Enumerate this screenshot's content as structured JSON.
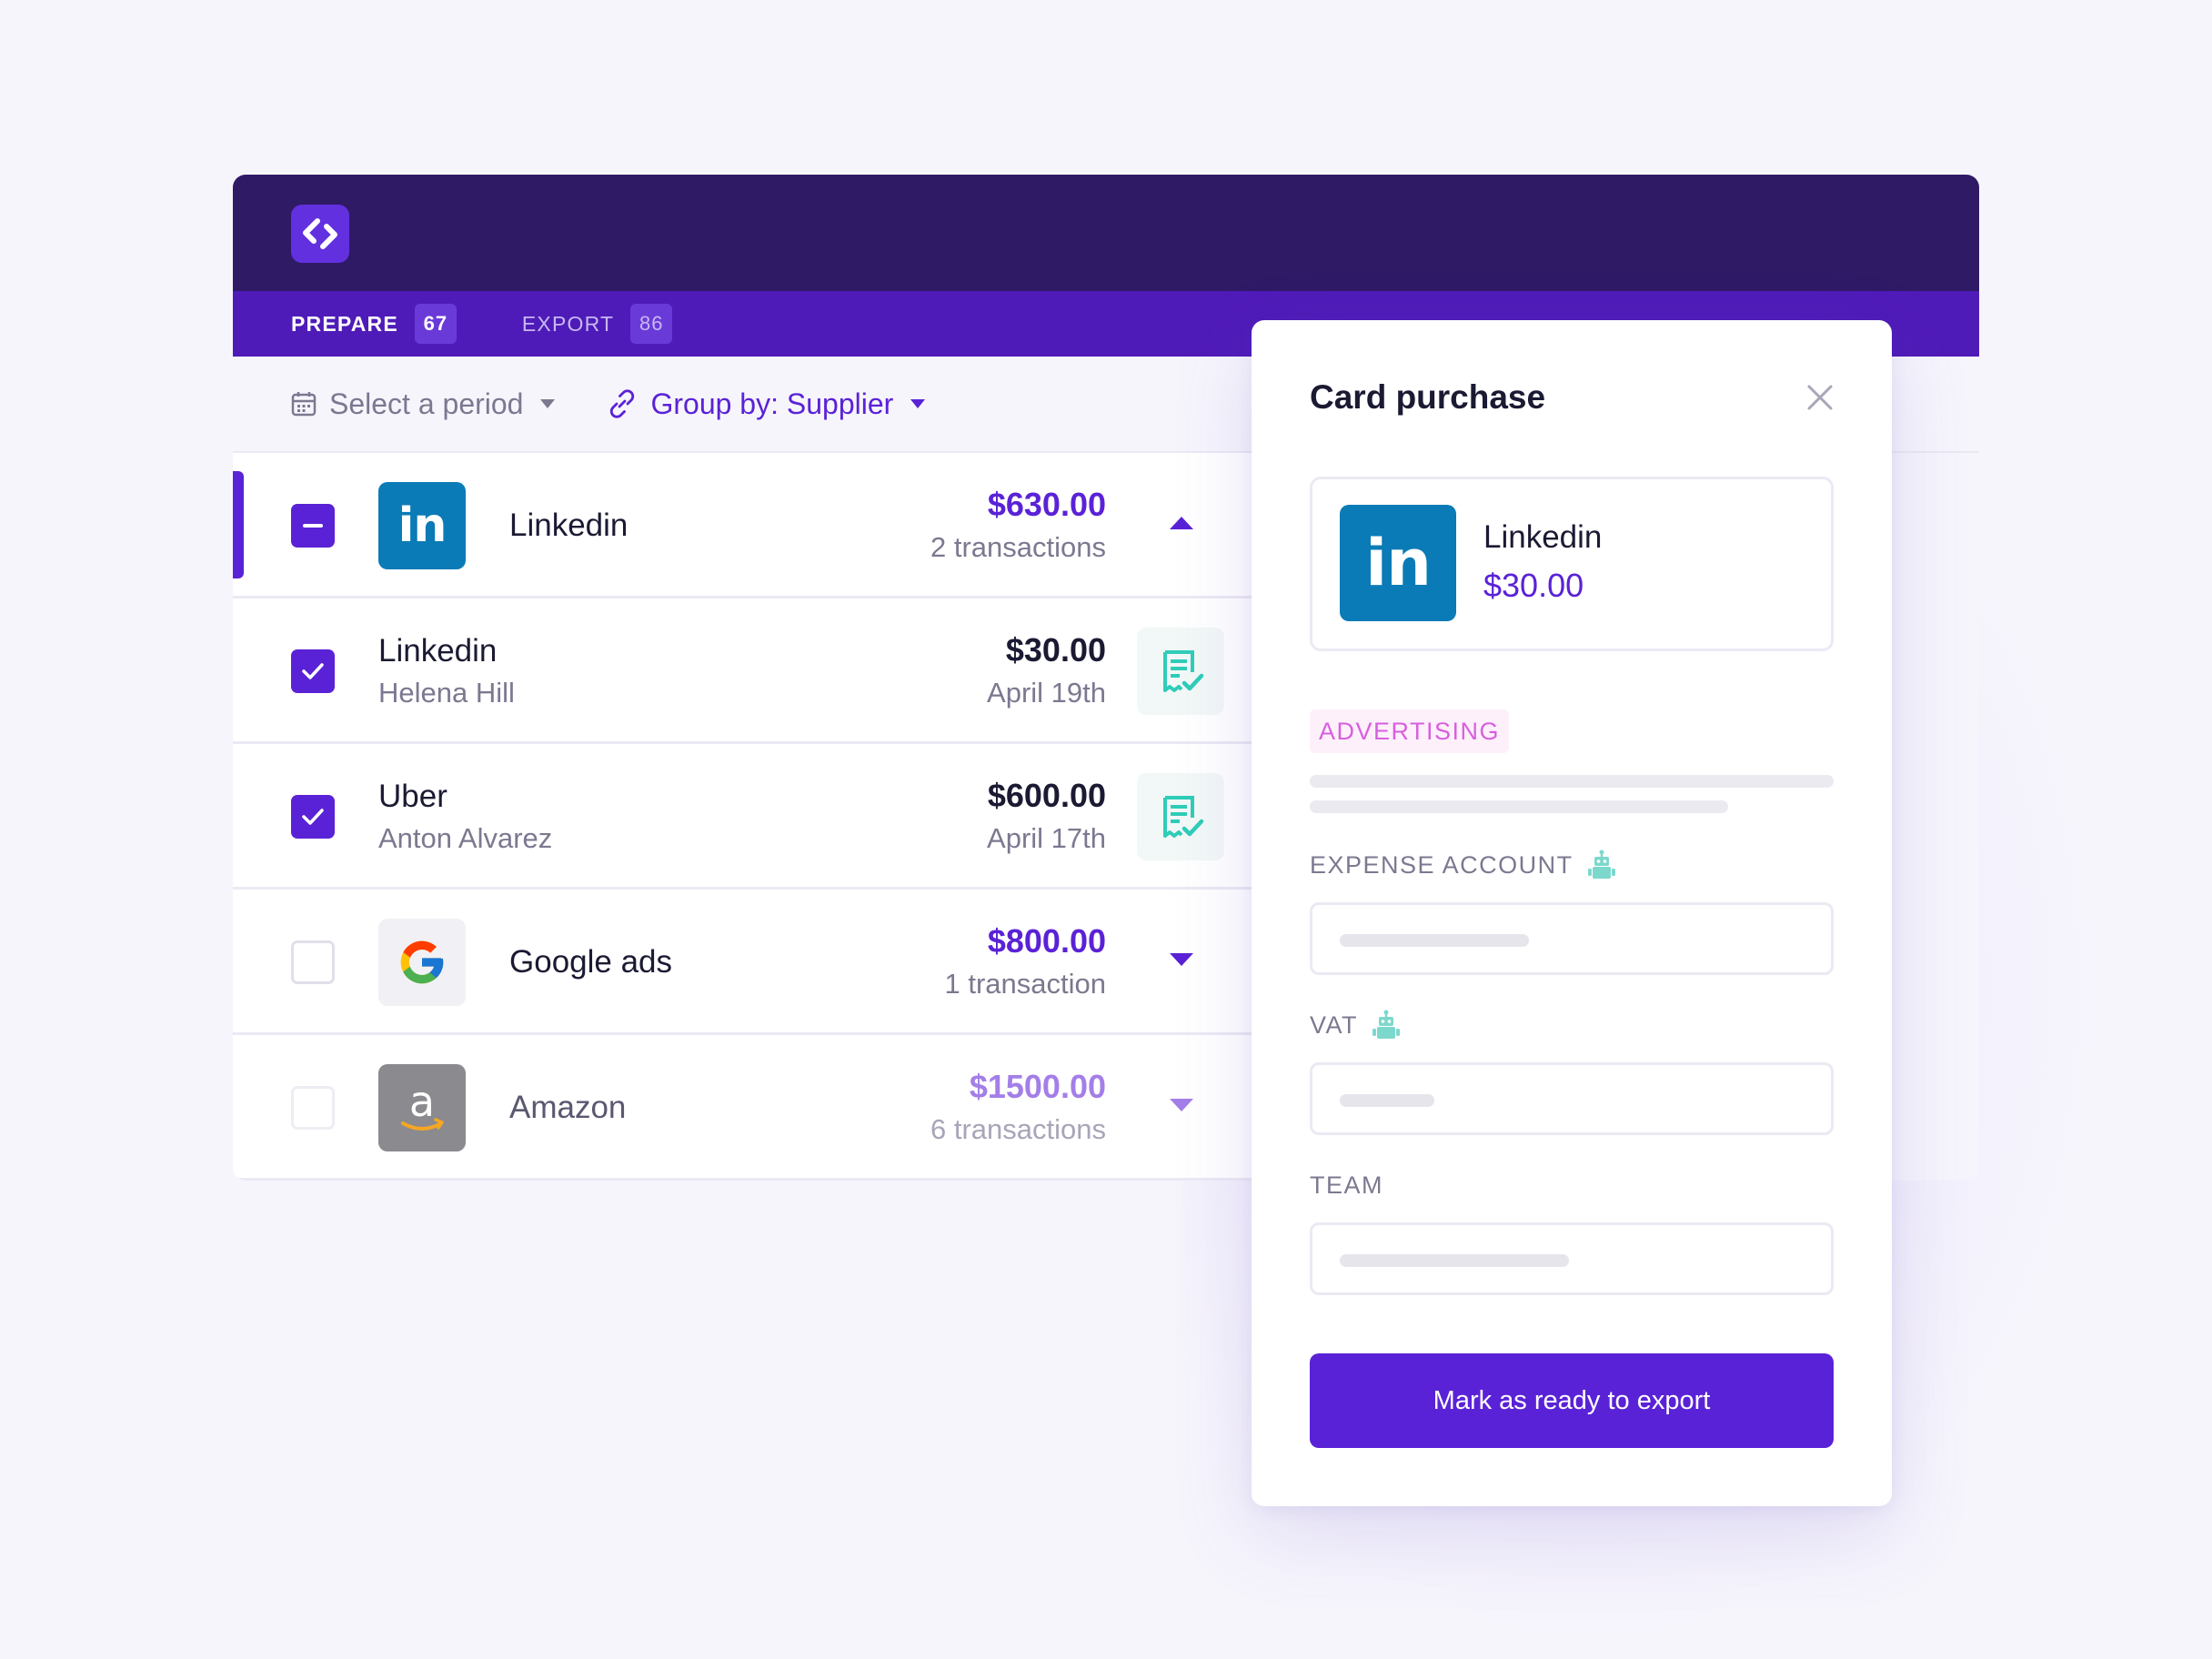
{
  "colors": {
    "accent": "#5a22d6",
    "topbar": "#2f1a66",
    "tabbar": "#4f1bb8",
    "receipt_ok": "#2fcdb8",
    "category": "#d85fde"
  },
  "logo": {
    "icon": "expense-app-logo-icon"
  },
  "tabs": [
    {
      "label": "PREPARE",
      "count": "67",
      "active": true
    },
    {
      "label": "EXPORT",
      "count": "86",
      "active": false
    }
  ],
  "filters": {
    "period": {
      "label": "Select a period",
      "icon": "calendar-icon"
    },
    "group": {
      "label": "Group by: Supplier",
      "icon": "link-icon"
    }
  },
  "groups": [
    {
      "name": "Linkedin",
      "logo_text": "in",
      "amount": "$630.00",
      "meta": "2 transactions",
      "expanded": true,
      "transactions": [
        {
          "title": "Linkedin",
          "person": "Helena Hill",
          "amount": "$30.00",
          "date": "April 19th"
        },
        {
          "title": "Uber",
          "person": "Anton Alvarez",
          "amount": "$600.00",
          "date": "April 17th"
        }
      ]
    },
    {
      "name": "Google ads",
      "logo_text": "G",
      "amount": "$800.00",
      "meta": "1 transaction",
      "expanded": false
    },
    {
      "name": "Amazon",
      "logo_text": "a",
      "amount": "$1500.00",
      "meta": "6 transactions",
      "expanded": false
    }
  ],
  "panel": {
    "title": "Card purchase",
    "supplier": {
      "name": "Linkedin",
      "amount": "$30.00",
      "logo_text": "in"
    },
    "category": "ADVERTISING",
    "fields": [
      {
        "label": "EXPENSE ACCOUNT",
        "auto": true
      },
      {
        "label": "VAT",
        "auto": true
      },
      {
        "label": "TEAM",
        "auto": false
      }
    ],
    "cta": "Mark as ready to export"
  }
}
